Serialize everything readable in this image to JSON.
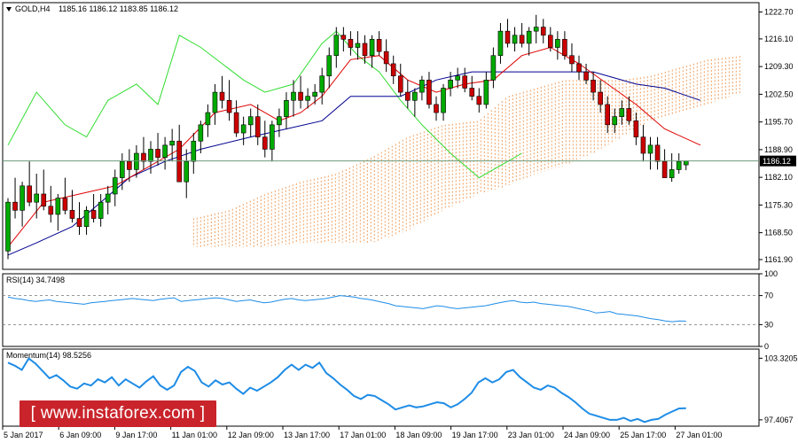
{
  "chart_data": [
    {
      "type": "candlestick",
      "symbol_label": "GOLD,H4",
      "ohlc_label": "1185.16 1186.12 1183.85 1186.12",
      "last_price": 1186.12,
      "last_price_label": "1186.12",
      "ylim": [
        1159.5,
        1225.0
      ],
      "y_ticks": [
        "1222.70",
        "1216.10",
        "1209.30",
        "1202.50",
        "1195.70",
        "1188.90",
        "1182.10",
        "1175.30",
        "1168.50",
        "1161.90"
      ],
      "x_ticks": [
        "5 Jan 2017",
        "6 Jan 09:00",
        "9 Jan 17:00",
        "11 Jan 01:00",
        "12 Jan 09:00",
        "13 Jan 17:00",
        "17 Jan 01:00",
        "18 Jan 09:00",
        "19 Jan 17:00",
        "23 Jan 01:00",
        "24 Jan 09:00",
        "25 Jan 17:00",
        "27 Jan 01:00"
      ],
      "colors": {
        "up": "#00aa00",
        "down": "#cc0000",
        "tenkan": "#e00000",
        "kijun": "#000090",
        "chikou": "#33dd33",
        "cloud": "#f0a060",
        "grid": "#777777"
      },
      "candles": [
        [
          1164,
          1177,
          1162,
          1176
        ],
        [
          1176,
          1182,
          1172,
          1174
        ],
        [
          1174,
          1181,
          1170,
          1180
        ],
        [
          1180,
          1186,
          1175,
          1176
        ],
        [
          1176,
          1183,
          1172,
          1178
        ],
        [
          1178,
          1184,
          1174,
          1175
        ],
        [
          1175,
          1180,
          1171,
          1173
        ],
        [
          1173,
          1178,
          1169,
          1177
        ],
        [
          1177,
          1182,
          1173,
          1174
        ],
        [
          1174,
          1179,
          1171,
          1172
        ],
        [
          1172,
          1176,
          1168,
          1170
        ],
        [
          1170,
          1175,
          1168,
          1174
        ],
        [
          1174,
          1178,
          1171,
          1172
        ],
        [
          1172,
          1178,
          1170,
          1176
        ],
        [
          1176,
          1180,
          1173,
          1178
        ],
        [
          1178,
          1184,
          1175,
          1182
        ],
        [
          1182,
          1188,
          1179,
          1186
        ],
        [
          1186,
          1189,
          1181,
          1184
        ],
        [
          1184,
          1190,
          1182,
          1188
        ],
        [
          1188,
          1192,
          1184,
          1186
        ],
        [
          1186,
          1191,
          1183,
          1189
        ],
        [
          1189,
          1193,
          1185,
          1187
        ],
        [
          1187,
          1192,
          1184,
          1190
        ],
        [
          1190,
          1194,
          1186,
          1191
        ],
        [
          1191,
          1195,
          1185,
          1181
        ],
        [
          1181,
          1189,
          1177,
          1186
        ],
        [
          1186,
          1193,
          1183,
          1191
        ],
        [
          1191,
          1196,
          1188,
          1195
        ],
        [
          1195,
          1200,
          1192,
          1198
        ],
        [
          1198,
          1205,
          1195,
          1203
        ],
        [
          1203,
          1207,
          1199,
          1201
        ],
        [
          1201,
          1206,
          1196,
          1198
        ],
        [
          1198,
          1201,
          1192,
          1193
        ],
        [
          1193,
          1197,
          1190,
          1195
        ],
        [
          1195,
          1199,
          1192,
          1197
        ],
        [
          1197,
          1200,
          1190,
          1192
        ],
        [
          1192,
          1196,
          1187,
          1189
        ],
        [
          1189,
          1196,
          1186,
          1195
        ],
        [
          1195,
          1199,
          1192,
          1197
        ],
        [
          1197,
          1203,
          1194,
          1201
        ],
        [
          1201,
          1206,
          1197,
          1203
        ],
        [
          1203,
          1207,
          1199,
          1201
        ],
        [
          1201,
          1204,
          1199,
          1202
        ],
        [
          1202,
          1205,
          1200,
          1203
        ],
        [
          1203,
          1209,
          1200,
          1207
        ],
        [
          1207,
          1214,
          1204,
          1212
        ],
        [
          1212,
          1219,
          1209,
          1217
        ],
        [
          1217,
          1219,
          1213,
          1216
        ],
        [
          1216,
          1218,
          1212,
          1214
        ],
        [
          1214,
          1218,
          1211,
          1215
        ],
        [
          1215,
          1217,
          1210,
          1212
        ],
        [
          1212,
          1217,
          1209,
          1216
        ],
        [
          1216,
          1218,
          1212,
          1213
        ],
        [
          1213,
          1216,
          1208,
          1210
        ],
        [
          1210,
          1212,
          1205,
          1207
        ],
        [
          1207,
          1210,
          1202,
          1203
        ],
        [
          1203,
          1206,
          1199,
          1201
        ],
        [
          1201,
          1204,
          1197,
          1203
        ],
        [
          1203,
          1207,
          1201,
          1206
        ],
        [
          1206,
          1208,
          1199,
          1200
        ],
        [
          1200,
          1202,
          1196,
          1198
        ],
        [
          1198,
          1205,
          1196,
          1204
        ],
        [
          1204,
          1208,
          1202,
          1206
        ],
        [
          1206,
          1209,
          1204,
          1207
        ],
        [
          1207,
          1209,
          1203,
          1204
        ],
        [
          1204,
          1207,
          1201,
          1202
        ],
        [
          1202,
          1204,
          1198,
          1200
        ],
        [
          1200,
          1208,
          1199,
          1206
        ],
        [
          1206,
          1214,
          1204,
          1212
        ],
        [
          1212,
          1220,
          1210,
          1218
        ],
        [
          1218,
          1221,
          1214,
          1215
        ],
        [
          1215,
          1219,
          1213,
          1217
        ],
        [
          1217,
          1220,
          1214,
          1215
        ],
        [
          1215,
          1219,
          1212,
          1218
        ],
        [
          1218,
          1222,
          1215,
          1219
        ],
        [
          1219,
          1221,
          1215,
          1217
        ],
        [
          1217,
          1219,
          1213,
          1214
        ],
        [
          1214,
          1218,
          1211,
          1216
        ],
        [
          1216,
          1218,
          1211,
          1212
        ],
        [
          1212,
          1215,
          1208,
          1210
        ],
        [
          1210,
          1212,
          1206,
          1208
        ],
        [
          1208,
          1210,
          1205,
          1206
        ],
        [
          1206,
          1208,
          1201,
          1203
        ],
        [
          1203,
          1206,
          1198,
          1200
        ],
        [
          1200,
          1202,
          1193,
          1195
        ],
        [
          1195,
          1199,
          1193,
          1197
        ],
        [
          1197,
          1201,
          1195,
          1199
        ],
        [
          1199,
          1202,
          1195,
          1196
        ],
        [
          1196,
          1198,
          1190,
          1192
        ],
        [
          1192,
          1195,
          1186,
          1188
        ],
        [
          1188,
          1192,
          1184,
          1190
        ],
        [
          1190,
          1192,
          1184,
          1186
        ],
        [
          1186,
          1189,
          1182,
          1182
        ],
        [
          1182,
          1188,
          1181,
          1184
        ],
        [
          1184,
          1188,
          1183,
          1186
        ],
        [
          1185.16,
          1186.12,
          1183.85,
          1186.12
        ]
      ],
      "tenkan": [
        [
          0,
          1165
        ],
        [
          5,
          1176
        ],
        [
          10,
          1178
        ],
        [
          15,
          1180
        ],
        [
          20,
          1185
        ],
        [
          24,
          1189
        ],
        [
          29,
          1198
        ],
        [
          34,
          1200
        ],
        [
          38,
          1196
        ],
        [
          41,
          1198
        ],
        [
          44,
          1202
        ],
        [
          48,
          1211
        ],
        [
          52,
          1212
        ],
        [
          56,
          1206
        ],
        [
          60,
          1203
        ],
        [
          64,
          1205
        ],
        [
          68,
          1206
        ],
        [
          72,
          1212
        ],
        [
          76,
          1214
        ],
        [
          80,
          1210
        ],
        [
          84,
          1205
        ],
        [
          88,
          1200
        ],
        [
          92,
          1194
        ],
        [
          97,
          1190
        ]
      ],
      "kijun": [
        [
          0,
          1163
        ],
        [
          4,
          1166
        ],
        [
          9,
          1170
        ],
        [
          13,
          1176
        ],
        [
          17,
          1182
        ],
        [
          22,
          1186
        ],
        [
          27,
          1189
        ],
        [
          34,
          1192
        ],
        [
          39,
          1194
        ],
        [
          44,
          1196
        ],
        [
          48,
          1202
        ],
        [
          55,
          1202
        ],
        [
          60,
          1206
        ],
        [
          65,
          1208
        ],
        [
          71,
          1208
        ],
        [
          77,
          1208
        ],
        [
          82,
          1208
        ],
        [
          88,
          1205
        ],
        [
          92,
          1204
        ],
        [
          97,
          1201
        ]
      ],
      "chikou": [
        [
          0,
          1190
        ],
        [
          4,
          1203
        ],
        [
          8,
          1195
        ],
        [
          11,
          1192
        ],
        [
          14,
          1201
        ],
        [
          18,
          1205
        ],
        [
          21,
          1200
        ],
        [
          24,
          1217
        ],
        [
          27,
          1214
        ],
        [
          30,
          1210
        ],
        [
          33,
          1206
        ],
        [
          36,
          1203
        ],
        [
          40,
          1205
        ],
        [
          44,
          1215
        ],
        [
          46,
          1218
        ],
        [
          49,
          1212
        ],
        [
          52,
          1208
        ],
        [
          55,
          1201
        ],
        [
          58,
          1195
        ],
        [
          62,
          1188
        ],
        [
          66,
          1182
        ],
        [
          70,
          1186
        ],
        [
          72,
          1188
        ]
      ],
      "cloud_upper": [
        [
          26,
          1172
        ],
        [
          31,
          1174
        ],
        [
          36,
          1178
        ],
        [
          41,
          1181
        ],
        [
          46,
          1183
        ],
        [
          51,
          1187
        ],
        [
          56,
          1192
        ],
        [
          61,
          1195
        ],
        [
          66,
          1196
        ],
        [
          70,
          1202
        ],
        [
          74,
          1204
        ],
        [
          78,
          1206
        ],
        [
          82,
          1206
        ],
        [
          86,
          1206
        ],
        [
          90,
          1207
        ],
        [
          94,
          1209
        ],
        [
          98,
          1211
        ],
        [
          103,
          1212
        ]
      ],
      "cloud_lower": [
        [
          26,
          1165
        ],
        [
          31,
          1165
        ],
        [
          36,
          1165
        ],
        [
          41,
          1166
        ],
        [
          46,
          1166
        ],
        [
          51,
          1166
        ],
        [
          56,
          1169
        ],
        [
          61,
          1174
        ],
        [
          66,
          1178
        ],
        [
          70,
          1180
        ],
        [
          74,
          1183
        ],
        [
          78,
          1185
        ],
        [
          82,
          1188
        ],
        [
          86,
          1192
        ],
        [
          90,
          1196
        ],
        [
          94,
          1198
        ],
        [
          98,
          1200
        ],
        [
          103,
          1203
        ]
      ]
    },
    {
      "type": "line",
      "title": "RSI(14) 34.7498",
      "ylim": [
        0,
        100
      ],
      "y_ticks": [
        "100",
        "70",
        "30",
        "0"
      ],
      "levels": [
        70,
        30
      ],
      "series": [
        {
          "color": "#1e8ce6",
          "values": [
            68,
            66,
            65,
            63,
            62,
            63,
            64,
            62,
            61,
            60,
            59,
            58,
            60,
            61,
            62,
            63,
            64,
            65,
            66,
            65,
            64,
            63,
            65,
            66,
            67,
            62,
            63,
            64,
            65,
            66,
            67,
            66,
            64,
            62,
            63,
            64,
            62,
            60,
            61,
            63,
            65,
            66,
            64,
            63,
            64,
            65,
            66,
            68,
            70,
            69,
            68,
            66,
            65,
            63,
            61,
            59,
            56,
            55,
            54,
            53,
            52,
            54,
            56,
            55,
            53,
            52,
            53,
            54,
            55,
            56,
            58,
            60,
            62,
            63,
            61,
            60,
            61,
            59,
            58,
            57,
            56,
            55,
            53,
            51,
            49,
            46,
            47,
            48,
            45,
            44,
            43,
            42,
            40,
            38,
            37,
            35,
            34,
            35,
            34.7498
          ]
        }
      ]
    },
    {
      "type": "line",
      "title": "Momentum(14) 98.5256",
      "ylim": [
        96.8,
        104.2
      ],
      "y_ticks": [
        "103.3205",
        "97.4067"
      ],
      "series": [
        {
          "color": "#1e8ce6",
          "values": [
            102.9,
            102.6,
            102.2,
            103.3,
            102.8,
            102.1,
            101.4,
            101.7,
            101.2,
            100.6,
            100.4,
            100.9,
            100.7,
            101.3,
            101.0,
            101.5,
            100.7,
            101.3,
            100.9,
            100.5,
            101.1,
            101.6,
            100.7,
            100.3,
            100.7,
            102.0,
            102.5,
            102.1,
            101.0,
            100.6,
            101.2,
            100.8,
            101.0,
            100.4,
            99.9,
            100.5,
            100.2,
            100.6,
            101.0,
            101.5,
            102.2,
            102.7,
            102.2,
            102.7,
            102.4,
            102.9,
            101.9,
            101.4,
            100.8,
            100.3,
            99.7,
            99.4,
            99.8,
            99.7,
            99.3,
            98.9,
            98.4,
            98.6,
            98.8,
            98.6,
            98.7,
            98.9,
            99.1,
            99.0,
            98.6,
            98.9,
            99.4,
            100.0,
            101.0,
            101.4,
            101.0,
            101.3,
            102.0,
            102.2,
            101.5,
            101.0,
            100.5,
            100.3,
            100.7,
            100.5,
            100.0,
            99.6,
            99.1,
            98.5,
            98.0,
            97.8,
            97.6,
            97.4,
            97.4,
            97.6,
            97.3,
            97.5,
            97.2,
            97.4,
            97.5,
            97.9,
            98.2,
            98.5,
            98.5256
          ]
        }
      ]
    }
  ],
  "watermark": {
    "text": "[  www.instaforex.com  ]"
  }
}
